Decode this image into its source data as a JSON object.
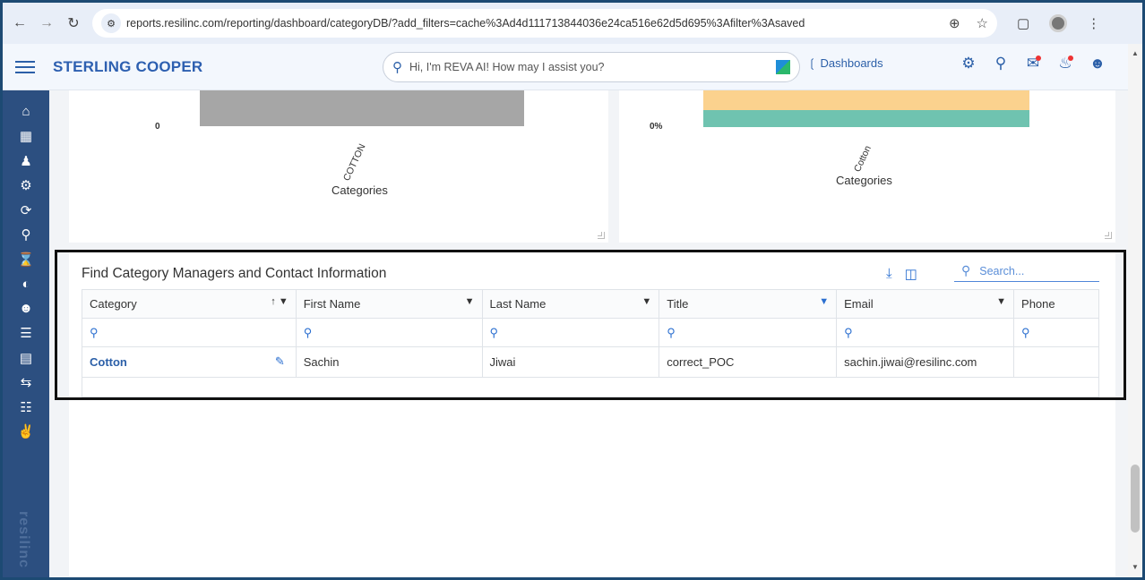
{
  "browser": {
    "url": "reports.resilinc.com/reporting/dashboard/categoryDB/?add_filters=cache%3Ad4d111713844036e24ca516e62d5d695%3Afilter%3Asaved"
  },
  "header": {
    "brand": "STERLING COOPER",
    "reva_placeholder": "Hi, I'm REVA AI! How may I assist you?",
    "dashboards_link": "Dashboards"
  },
  "sidebar": {
    "items": [
      "home-icon",
      "calendar-icon",
      "hierarchy-icon",
      "factory-icon",
      "cycle-icon",
      "search-person-icon",
      "hourglass-icon",
      "gauge-icon",
      "users-icon",
      "checklist-icon",
      "clipboard-icon",
      "transfer-icon",
      "new-network-icon",
      "handshake-icon"
    ],
    "watermark": "resilinc"
  },
  "charts": {
    "left": {
      "zero_label": "0",
      "x_tick": "COTTON",
      "x_title": "Categories"
    },
    "right": {
      "zero_label": "0%",
      "x_tick": "Cotton",
      "x_title": "Categories"
    }
  },
  "chart_data": [
    {
      "type": "bar",
      "categories": [
        "COTTON"
      ],
      "xlabel": "Categories",
      "colors": [
        "#a6a6a6"
      ]
    },
    {
      "type": "bar",
      "categories": [
        "Cotton"
      ],
      "xlabel": "Categories",
      "stacked": true,
      "colors": [
        "#fbd28e",
        "#6fc3b0"
      ]
    }
  ],
  "table": {
    "title": "Find Category Managers and Contact Information",
    "search_placeholder": "Search...",
    "columns": [
      "Category",
      "First Name",
      "Last Name",
      "Title",
      "Email",
      "Phone"
    ],
    "rows": [
      {
        "category": "Cotton",
        "first_name": "Sachin",
        "last_name": "Jiwai",
        "title": "correct_POC",
        "email": "sachin.jiwai@resilinc.com",
        "phone": ""
      }
    ]
  },
  "colors": {
    "accent": "#2b5fa8",
    "sidebar": "#2c4f80",
    "frame": "#1d4a73"
  }
}
